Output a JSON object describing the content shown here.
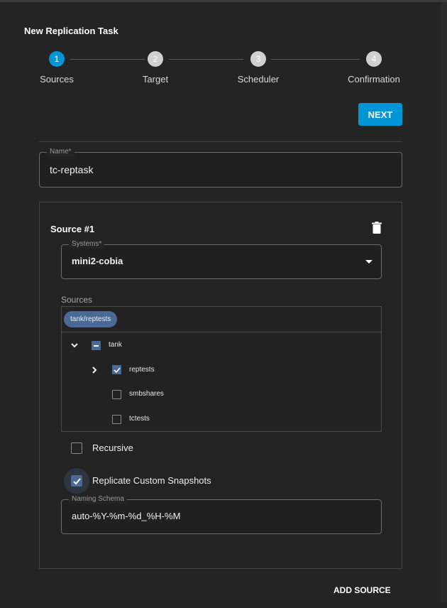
{
  "title": "New Replication Task",
  "stepper": {
    "steps": [
      {
        "number": "1",
        "label": "Sources",
        "active": true
      },
      {
        "number": "2",
        "label": "Target",
        "active": false
      },
      {
        "number": "3",
        "label": "Scheduler",
        "active": false
      },
      {
        "number": "4",
        "label": "Confirmation",
        "active": false
      }
    ]
  },
  "actions": {
    "next_label": "NEXT",
    "add_source_label": "ADD SOURCE"
  },
  "name_field": {
    "label": "Name*",
    "value": "tc-reptask"
  },
  "source": {
    "title": "Source #1",
    "delete_icon": "trash-icon",
    "systems": {
      "label": "Systems*",
      "value": "mini2-cobia",
      "icon": "dropdown-arrow-icon"
    },
    "sources_label": "Sources",
    "selected_chips": [
      "tank/reptests"
    ],
    "tree": [
      {
        "name": "tank",
        "state": "indeterminate",
        "expander": "expanded"
      },
      {
        "name": "reptests",
        "state": "checked",
        "expander": "collapsed"
      },
      {
        "name": "smbshares",
        "state": "unchecked",
        "expander": "none"
      },
      {
        "name": "tctests",
        "state": "unchecked",
        "expander": "none"
      }
    ],
    "recursive": {
      "label": "Recursive",
      "checked": false
    },
    "replicate_custom": {
      "label": "Replicate Custom Snapshots",
      "checked": true
    },
    "naming_schema": {
      "label": "Naming Schema",
      "value": "auto-%Y-%m-%d_%H-%M"
    }
  },
  "colors": {
    "accent": "#0095d5",
    "chip": "#4a6a95",
    "background": "#242424"
  }
}
